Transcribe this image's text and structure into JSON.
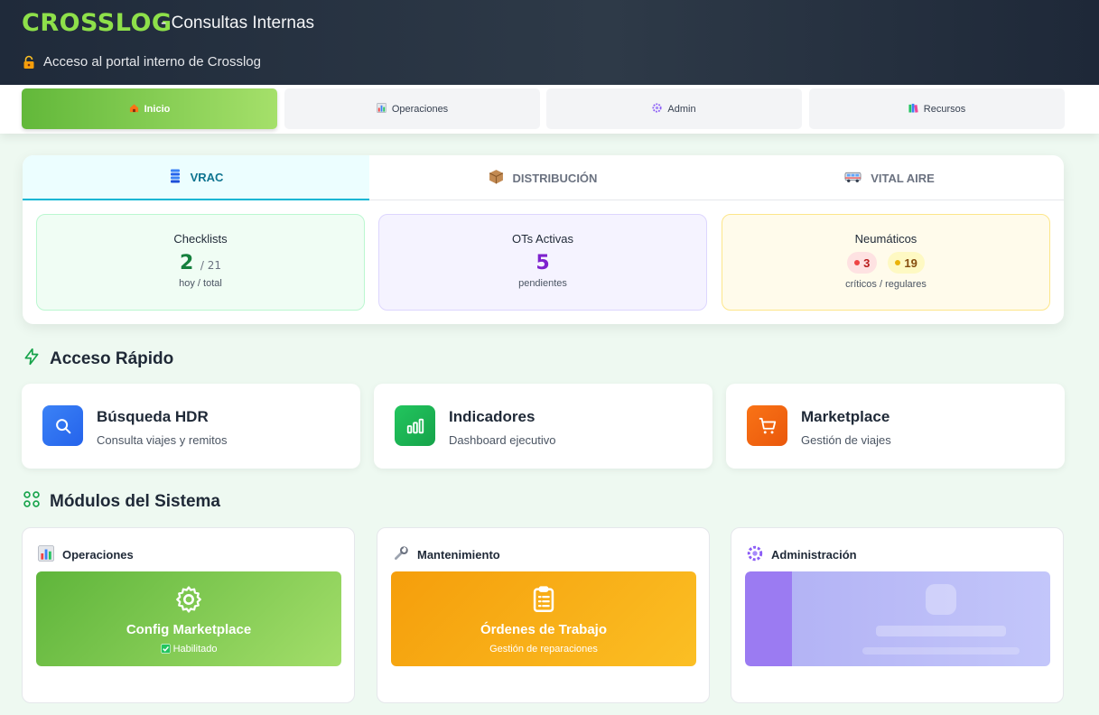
{
  "header": {
    "brand": "CROSSLOG",
    "subtitle": "- Consultas Internas",
    "portal_text": "Acceso al portal interno de Crosslog"
  },
  "nav": [
    {
      "label": "Inicio",
      "icon": "home-icon",
      "active": true
    },
    {
      "label": "Operaciones",
      "icon": "bar-chart-icon",
      "active": false
    },
    {
      "label": "Admin",
      "icon": "gear-icon",
      "active": false
    },
    {
      "label": "Recursos",
      "icon": "books-icon",
      "active": false
    }
  ],
  "summary": {
    "tabs": [
      {
        "label": "VRAC",
        "icon": "tank-icon",
        "active": true
      },
      {
        "label": "DISTRIBUCIÓN",
        "icon": "package-icon",
        "active": false
      },
      {
        "label": "VITAL AIRE",
        "icon": "bus-icon",
        "active": false
      }
    ],
    "checklists": {
      "label": "Checklists",
      "today": "2",
      "total": "/ 21",
      "caption": "hoy / total",
      "color": "#15803d"
    },
    "ots": {
      "label": "OTs Activas",
      "value": "5",
      "caption": "pendientes",
      "color": "#7e22ce"
    },
    "tires": {
      "label": "Neumáticos",
      "critical": "3",
      "regular": "19",
      "caption": "críticos / regulares"
    }
  },
  "quick_access": {
    "title": "Acceso Rápido",
    "items": [
      {
        "title": "Búsqueda HDR",
        "subtitle": "Consulta viajes y remitos",
        "icon": "search-icon",
        "color": "#3b82f6"
      },
      {
        "title": "Indicadores",
        "subtitle": "Dashboard ejecutivo",
        "icon": "bar-chart-icon",
        "color": "#16a34a"
      },
      {
        "title": "Marketplace",
        "subtitle": "Gestión de viajes",
        "icon": "cart-icon",
        "color": "#ea580c"
      }
    ]
  },
  "modules": {
    "title": "Módulos del Sistema",
    "cards": [
      {
        "header": "Operaciones",
        "tile_title": "Config Marketplace",
        "tile_sub": "Habilitado"
      },
      {
        "header": "Mantenimiento",
        "tile_title": "Órdenes de Trabajo",
        "tile_sub": "Gestión de reparaciones"
      },
      {
        "header": "Administración",
        "tile_title": "",
        "tile_sub": ""
      }
    ]
  }
}
